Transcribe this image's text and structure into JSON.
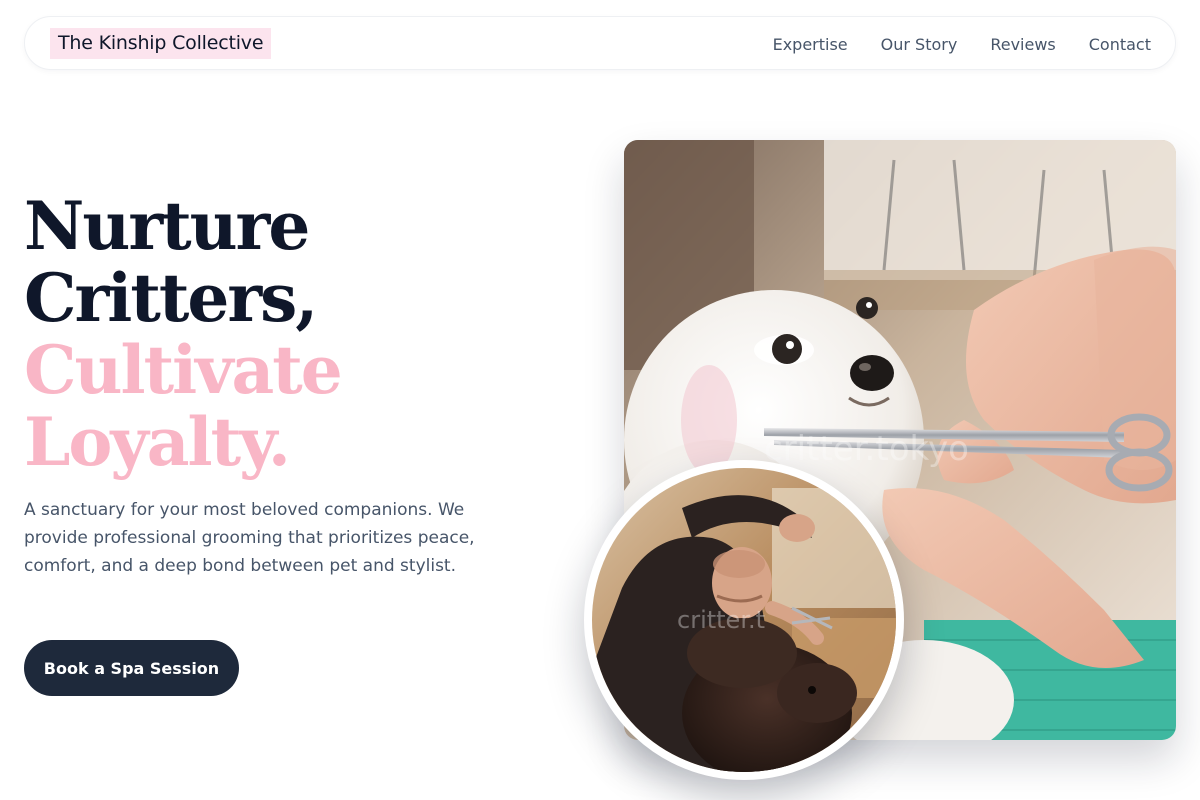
{
  "nav": {
    "logo": "The Kinship Collective",
    "links": [
      "Expertise",
      "Our Story",
      "Reviews",
      "Contact"
    ]
  },
  "hero": {
    "title_lines": [
      "Nurture",
      "Critters,",
      "Cultivate",
      "Loyalty."
    ],
    "description": "A sanctuary for your most beloved companions. We provide professional grooming that prioritizes peace, comfort, and a deep bond between pet and stylist.",
    "cta_label": "Book a Spa Session"
  },
  "images": {
    "main_watermark": "critter.tokyo",
    "circle_watermark": "critter.t"
  },
  "colors": {
    "accent_pink": "#f9b6c6",
    "dark_navy": "#1e293b",
    "logo_highlight": "#fce4ee"
  }
}
